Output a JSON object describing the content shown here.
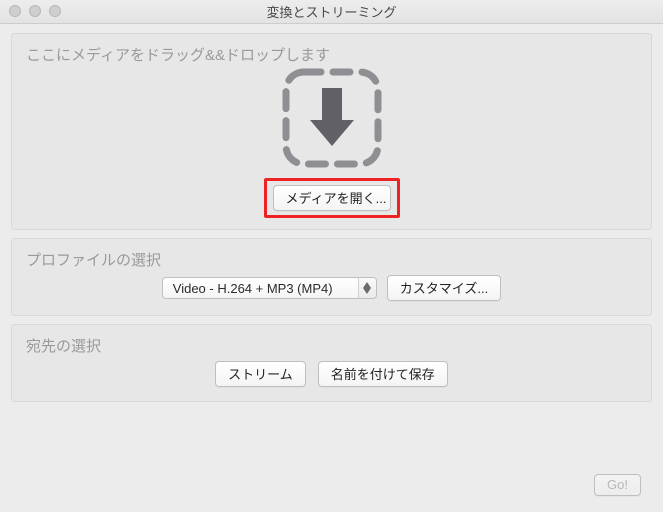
{
  "window": {
    "title": "変換とストリーミング"
  },
  "drop": {
    "label": "ここにメディアをドラッグ&&ドロップします",
    "open_button": "メディアを開く..."
  },
  "profile": {
    "label": "プロファイルの選択",
    "selected": "Video - H.264 + MP3 (MP4)",
    "customize_button": "カスタマイズ..."
  },
  "destination": {
    "label": "宛先の選択",
    "stream_button": "ストリーム",
    "save_as_button": "名前を付けて保存"
  },
  "footer": {
    "go_button": "Go!"
  }
}
